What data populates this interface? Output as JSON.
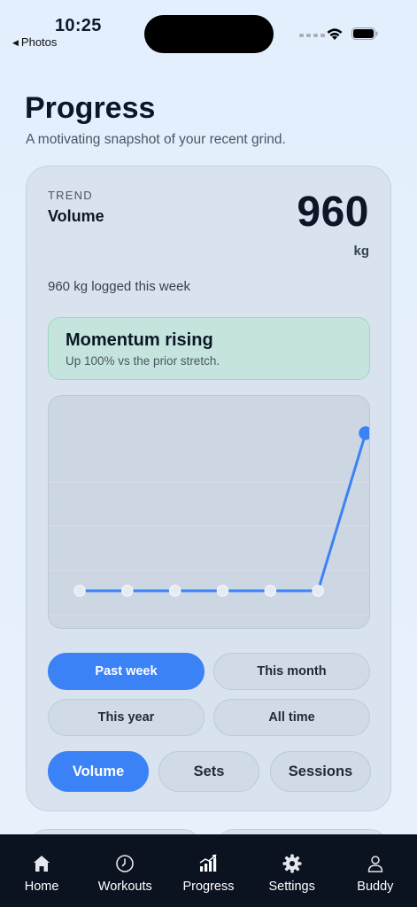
{
  "status_bar": {
    "time": "10:25",
    "back_app": "Photos"
  },
  "header": {
    "title": "Progress",
    "subtitle": "A motivating snapshot of your recent grind."
  },
  "card": {
    "eyebrow": "TREND",
    "metric_name": "Volume",
    "metric_value": "960",
    "metric_unit": "kg",
    "summary": "960 kg logged this week",
    "momentum": {
      "title": "Momentum rising",
      "subtitle": "Up 100% vs the prior stretch."
    },
    "ranges": [
      {
        "label": "Past week",
        "active": true
      },
      {
        "label": "This month",
        "active": false
      },
      {
        "label": "This year",
        "active": false
      },
      {
        "label": "All time",
        "active": false
      }
    ],
    "metrics": [
      {
        "label": "Volume",
        "active": true
      },
      {
        "label": "Sets",
        "active": false
      },
      {
        "label": "Sessions",
        "active": false
      }
    ]
  },
  "chart_data": {
    "type": "line",
    "x": [
      1,
      2,
      3,
      4,
      5,
      6,
      7
    ],
    "series": [
      {
        "values": [
          0,
          0,
          0,
          0,
          0,
          0,
          960
        ],
        "color": "#3b82f6"
      }
    ],
    "ylim": [
      0,
      960
    ],
    "grid": true,
    "line_color": "#3b82f6",
    "point_fill_empty": "#e5ebf3"
  },
  "tab_bar": {
    "tabs": [
      {
        "label": "Home",
        "icon": "home-icon"
      },
      {
        "label": "Workouts",
        "icon": "clock-icon"
      },
      {
        "label": "Progress",
        "icon": "bar-chart-icon"
      },
      {
        "label": "Settings",
        "icon": "gear-icon"
      },
      {
        "label": "Buddy",
        "icon": "person-icon"
      }
    ]
  },
  "colors": {
    "accent": "#3b82f6",
    "tab_bar_bg": "#0b1220",
    "momentum_bg": "#c5e4dd"
  }
}
